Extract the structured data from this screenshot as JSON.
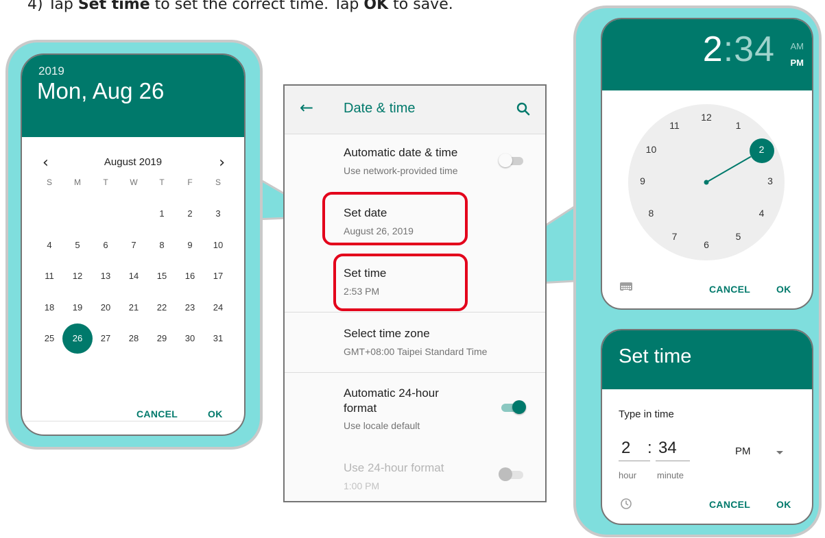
{
  "instruction": {
    "step_prefix": "4)  Tap ",
    "set_time_bold": "Set time",
    "middle": " to set the correct time. Tap ",
    "ok_bold": "OK",
    "suffix": " to save."
  },
  "date_picker": {
    "year": "2019",
    "date": "Mon, Aug 26",
    "month_label": "August 2019",
    "weekdays": [
      "S",
      "M",
      "T",
      "W",
      "T",
      "F",
      "S"
    ],
    "days": [
      "1",
      "2",
      "3",
      "4",
      "5",
      "6",
      "7",
      "8",
      "9",
      "10",
      "11",
      "12",
      "13",
      "14",
      "15",
      "16",
      "17",
      "18",
      "19",
      "20",
      "21",
      "22",
      "23",
      "24",
      "25",
      "26",
      "27",
      "28",
      "29",
      "30",
      "31"
    ],
    "selected_day": "26",
    "cancel": "CANCEL",
    "ok": "OK"
  },
  "settings": {
    "title": "Date & time",
    "items": [
      {
        "title": "Automatic date & time",
        "subtitle": "Use network-provided time",
        "toggle": "off"
      },
      {
        "title": "Set date",
        "subtitle": "August 26, 2019"
      },
      {
        "title": "Set time",
        "subtitle": "2:53 PM"
      },
      {
        "title": "Select time zone",
        "subtitle": "GMT+08:00 Taipei Standard Time"
      },
      {
        "title_line1": "Automatic 24-hour",
        "title_line2": "format",
        "subtitle": "Use locale default",
        "toggle": "on"
      },
      {
        "title": "Use 24-hour format",
        "subtitle": "1:00 PM",
        "toggle": "disabled"
      }
    ]
  },
  "clock_picker": {
    "hour": "2",
    "separator": ":",
    "minute": "34",
    "am": "AM",
    "pm": "PM",
    "dial_numbers": [
      "12",
      "1",
      "2",
      "3",
      "4",
      "5",
      "6",
      "7",
      "8",
      "9",
      "10",
      "11"
    ],
    "selected_hour": "2",
    "cancel": "CANCEL",
    "ok": "OK"
  },
  "type_in": {
    "title": "Set time",
    "label": "Type in time",
    "hour": "2",
    "colon": ":",
    "minute": "34",
    "hour_caption": "hour",
    "minute_caption": "minute",
    "ampm": "PM",
    "cancel": "CANCEL",
    "ok": "OK"
  },
  "colors": {
    "accent": "#00796b",
    "callout": "#7fdedd",
    "highlight": "#e3001b"
  }
}
